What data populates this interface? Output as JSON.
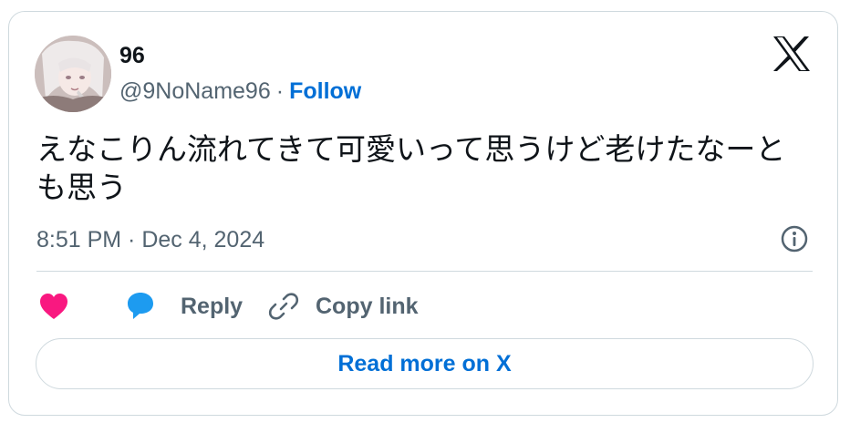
{
  "author": {
    "display_name": "96",
    "handle": "@9NoName96",
    "separator": "·",
    "follow_label": "Follow"
  },
  "tweet": {
    "text": "えなこりん流れてきて可愛いって思うけど老けたなーとも思う",
    "timestamp": "8:51 PM · Dec 4, 2024"
  },
  "actions": {
    "reply_label": "Reply",
    "copy_link_label": "Copy link"
  },
  "read_more_label": "Read more on X",
  "icons": {
    "logo": "x-logo-icon",
    "info": "info-icon",
    "like": "heart-icon",
    "reply": "speech-bubble-icon",
    "copy": "link-icon"
  },
  "colors": {
    "like": "#f91880",
    "reply": "#1d9bf0",
    "link": "#006fd6",
    "text": "#0f1419",
    "muted": "#536471",
    "border": "#cfd9de"
  }
}
